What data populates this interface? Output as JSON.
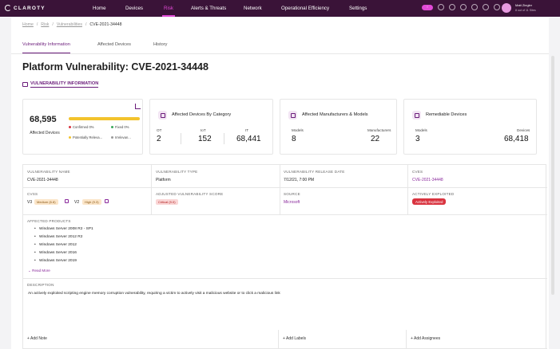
{
  "app": {
    "brand": "CLAROTY"
  },
  "nav": [
    {
      "label": "Home"
    },
    {
      "label": "Devices"
    },
    {
      "label": "Risk",
      "active": true
    },
    {
      "label": "Alerts & Threats"
    },
    {
      "label": "Network"
    },
    {
      "label": "Operational Efficiency"
    },
    {
      "label": "Settings"
    }
  ],
  "user": {
    "name": "Matt Ziegler",
    "sub": "8 out of 11 Sites"
  },
  "breadcrumb": {
    "home": "Home",
    "risk": "Risk",
    "vulns": "Vulnerabilities",
    "sep": "/",
    "current": "CVE-2021-34448"
  },
  "tabs": [
    {
      "label": "Vulnerability Information",
      "active": true
    },
    {
      "label": "Affected Devices"
    },
    {
      "label": "History"
    }
  ],
  "page_title": "Platform Vulnerability: CVE-2021-34448",
  "section_title": "VULNERABILITY INFORMATION",
  "affected_card": {
    "count": "68,595",
    "label": "Affected Devices",
    "legend": [
      {
        "label": "Confirmed 0%",
        "color": "#d9333f"
      },
      {
        "label": "Fixed 0%",
        "color": "#3aa85b"
      },
      {
        "label": "Potentially Releva...",
        "color": "#f3c32c"
      },
      {
        "label": "Irrelevan...",
        "color": "#999999"
      }
    ]
  },
  "category_card": {
    "title": "Affected Devices By Category",
    "stats": [
      {
        "label": "OT",
        "value": "2"
      },
      {
        "label": "IoT",
        "value": "152"
      },
      {
        "label": "IT",
        "value": "68,441"
      }
    ]
  },
  "manufacturers_card": {
    "title": "Affected Manufacturers & Models",
    "stats": [
      {
        "label": "Models",
        "value": "8"
      },
      {
        "label": "Manufacturers",
        "value": "22"
      }
    ]
  },
  "remediable_card": {
    "title": "Remediable Devices",
    "stats": [
      {
        "label": "Models",
        "value": "3"
      },
      {
        "label": "Devices",
        "value": "68,418"
      }
    ]
  },
  "details": {
    "name_label": "VULNERABILITY NAME",
    "name_value": "CVE-2021-34448",
    "type_label": "VULNERABILITY TYPE",
    "type_value": "Platform",
    "date_label": "VULNERABILITY RELEASE DATE",
    "date_value": "7/12/21, 7:00 PM",
    "cves_label": "CVES",
    "cves_value": "CVE-2021-34448",
    "cvss_label": "CVSS",
    "cvss_v3": "V3",
    "cvss_v3_badge": "Medium (6.8)",
    "cvss_v2": "V2",
    "cvss_v2_badge": "High (9.3)",
    "adjusted_label": "ADJUSTED VULNERABILITY SCORE",
    "adjusted_badge": "Critical (9.0)",
    "source_label": "SOURCE",
    "source_value": "Microsoft",
    "exploited_label": "ACTIVELY EXPLOITED",
    "exploited_badge": "Actively Exploited",
    "products_label": "AFFECTED PRODUCTS",
    "products": [
      "Windows Server 2008 R2 - SP1",
      "Windows Server 2012 R2",
      "Windows Server 2012",
      "Windows Server 2016",
      "Windows Server 2019"
    ],
    "read_more": "Read More",
    "description_label": "DESCRIPTION",
    "description": "An actively exploited scripting engine memory corruption vulnerability, requiring a victim to actively visit a malicious website or to click a malicious link"
  },
  "footer": {
    "add_note": "+ Add Note",
    "add_labels": "+ Add Labels",
    "add_assignees": "+ Add Assignees"
  }
}
